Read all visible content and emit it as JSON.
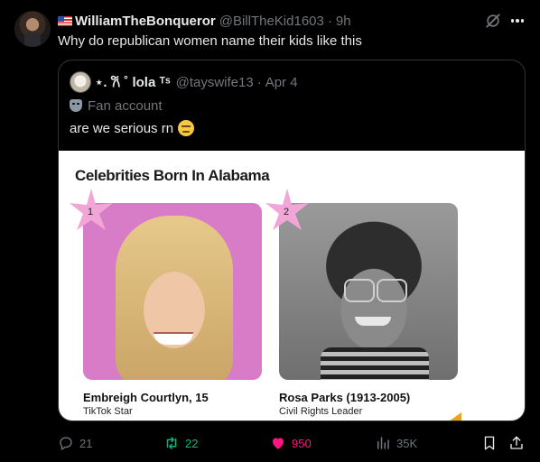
{
  "tweet": {
    "author_name": "WilliamTheBonqueror",
    "handle": "@BillTheKid1603",
    "separator": "·",
    "time": "9h",
    "text": "Why do republican women name their kids like this",
    "author_flag_icon": "flag-icon"
  },
  "quote": {
    "author_name": "⋆. 𐙚 ˚ lola ᵀˢ",
    "handle": "@tayswife13",
    "separator": "·",
    "time": "Apr 4",
    "label": "Fan account",
    "text": "are we serious rn",
    "emoji_icon": "expressionless-face-icon",
    "media": {
      "title": "Celebrities Born In Alabama",
      "items": [
        {
          "rank": "1",
          "name": "Embreigh Courtlyn, 15",
          "role": "TikTok Star"
        },
        {
          "rank": "2",
          "name": "Rosa Parks (1913-2005)",
          "role": "Civil Rights Leader"
        }
      ]
    }
  },
  "actions": {
    "replies": "21",
    "reposts": "22",
    "likes": "950",
    "views": "35K"
  },
  "colors": {
    "background": "#000000",
    "text": "#e7e9ea",
    "muted": "#71767b",
    "border": "#2f3336",
    "repost_active": "#00ba7c",
    "like_active": "#f91880",
    "rank_star": "#f2a6d8"
  }
}
